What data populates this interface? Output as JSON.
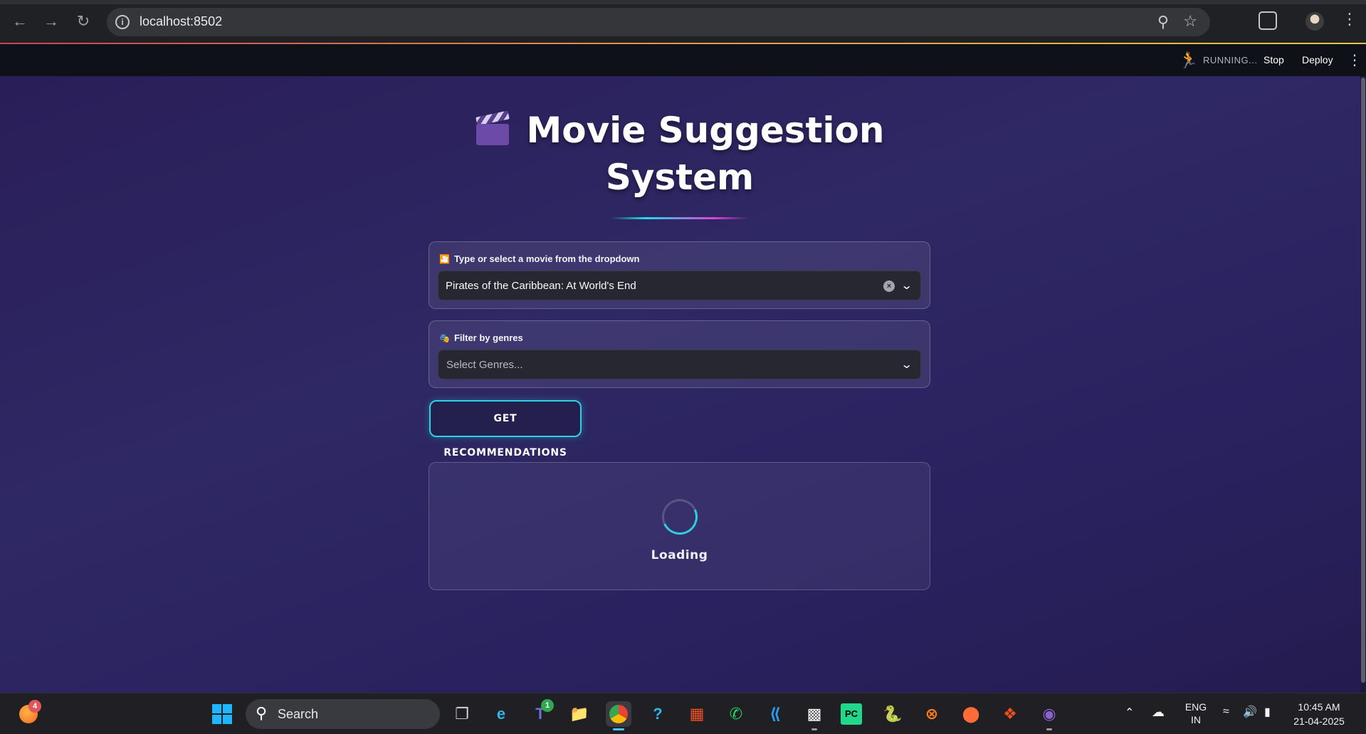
{
  "browser": {
    "url": "localhost:8502",
    "back_icon": "arrow-left-icon",
    "forward_icon": "arrow-right-icon",
    "reload_icon": "reload-icon"
  },
  "streamlit_header": {
    "status": "RUNNING...",
    "stop_label": "Stop",
    "deploy_label": "Deploy"
  },
  "app": {
    "title_line1": "Movie Suggestion",
    "title_line2": "System",
    "movie_select": {
      "label": "Type or select a movie from the dropdown",
      "value": "Pirates of the Caribbean: At World's End"
    },
    "genre_select": {
      "label": "Filter by genres",
      "placeholder": "Select Genres..."
    },
    "button_label": "GET RECOMMENDATIONS",
    "loading_text": "Loading",
    "colors": {
      "accent_cyan": "#28d3e3",
      "accent_magenta": "#e040d8",
      "background": "#2a2260"
    }
  },
  "taskbar": {
    "search_label": "Search",
    "notification_badge": "4",
    "teams_badge": "1",
    "language_line1": "ENG",
    "language_line2": "IN",
    "time": "10:45 AM",
    "date": "21-04-2025"
  }
}
